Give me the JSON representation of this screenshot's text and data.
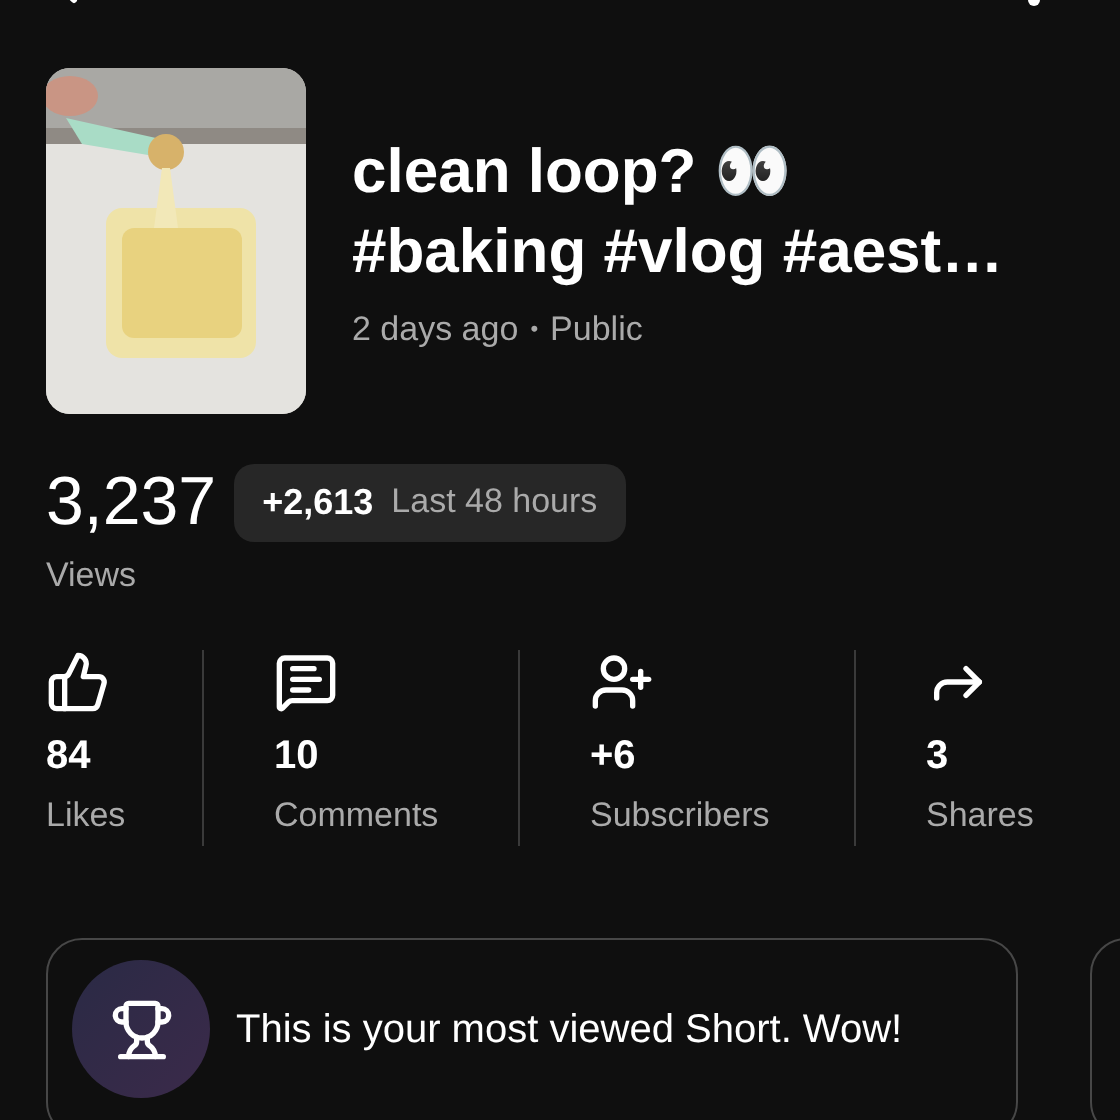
{
  "video": {
    "kind": "picture",
    "title_lines": [
      "clean loop? 👀",
      "#baking #vlog #aest…"
    ],
    "age": "2 days ago",
    "separator": "•",
    "visibility": "Public"
  },
  "views": {
    "count": "3,237",
    "delta": "+2,613",
    "period": "Last 48 hours",
    "label": "Views"
  },
  "stats": [
    {
      "kind": "likes",
      "value": "84",
      "label": "Likes"
    },
    {
      "kind": "comments",
      "value": "10",
      "label": "Comments"
    },
    {
      "kind": "subscribers",
      "value": "+6",
      "label": "Subscribers"
    },
    {
      "kind": "shares",
      "value": "3",
      "label": "Shares"
    }
  ],
  "highlights": [
    {
      "kind": "trophy",
      "text": "This is your most viewed Short. Wow!"
    }
  ]
}
